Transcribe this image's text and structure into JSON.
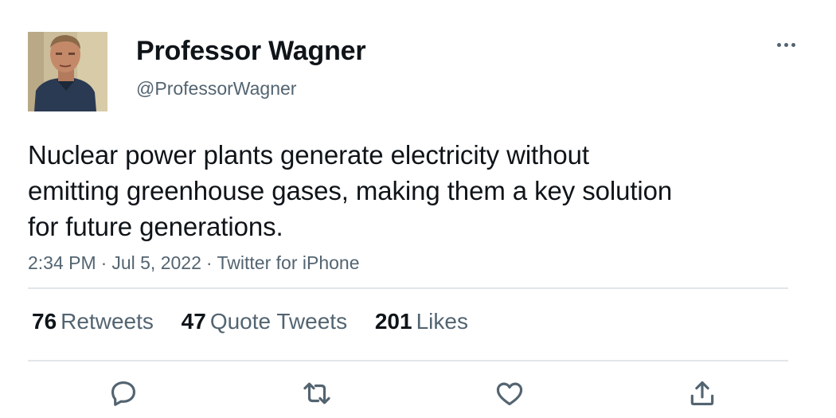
{
  "author": {
    "display_name": "Professor Wagner",
    "handle": "@ProfessorWagner",
    "avatar_icon": "profile-photo"
  },
  "tweet": {
    "text_lines": [
      "Nuclear power plants generate electricity without",
      "emitting greenhouse gases, making them a key solution",
      "for future generations."
    ],
    "time": "2:34 PM",
    "date": "Jul 5, 2022",
    "separator": "·",
    "source": "Twitter for iPhone"
  },
  "stats": [
    {
      "count": "76",
      "label": "Retweets"
    },
    {
      "count": "47",
      "label": "Quote Tweets"
    },
    {
      "count": "201",
      "label": "Likes"
    }
  ],
  "actions": [
    "reply-icon",
    "retweet-icon",
    "like-icon",
    "share-icon"
  ],
  "more_icon": "more-options-icon",
  "colors": {
    "text": "#0f1419",
    "secondary": "#536471",
    "divider": "#e1e6ea"
  }
}
